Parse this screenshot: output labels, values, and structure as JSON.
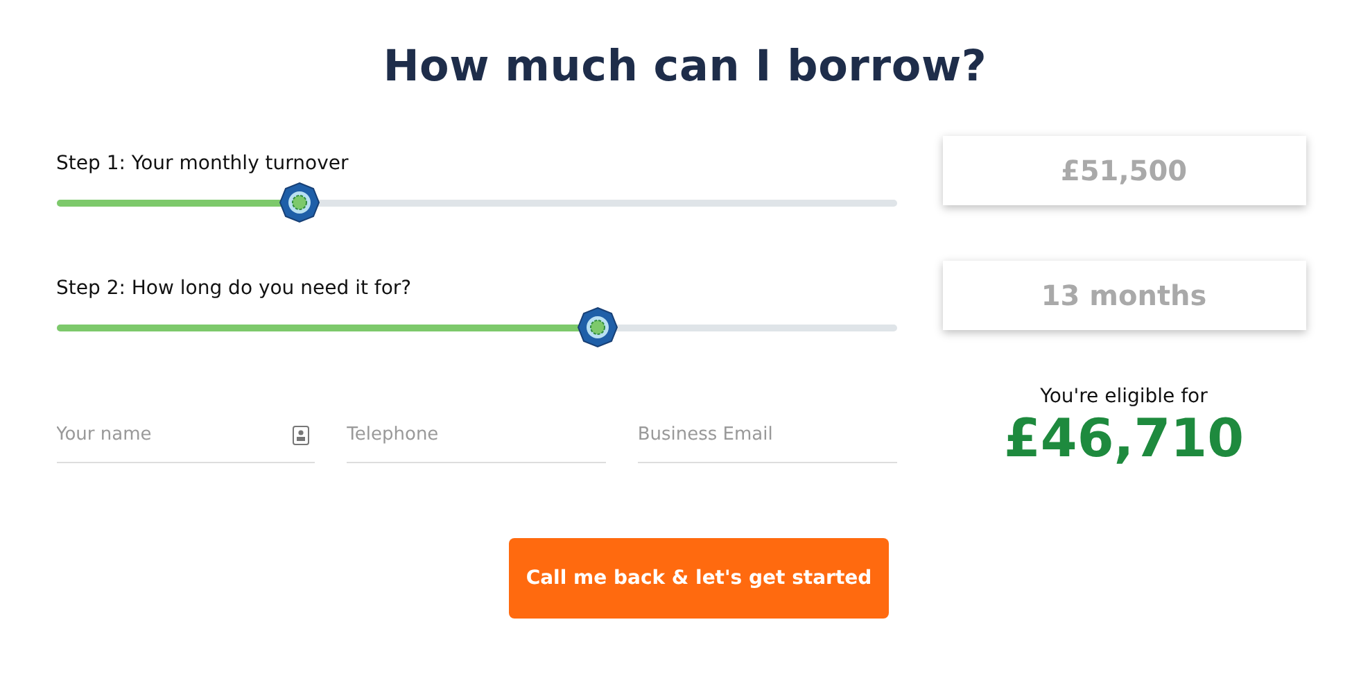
{
  "title": "How much can I borrow?",
  "steps": [
    {
      "label": "Step 1: Your monthly turnover",
      "level": 0.29,
      "reading": "£51,500"
    },
    {
      "label": "Step 2: How long do you need it for?",
      "level": 0.644,
      "reading": "13 months"
    }
  ],
  "fields": [
    {
      "placeholder": "Your name",
      "kind": "contact"
    },
    {
      "placeholder": "Telephone",
      "kind": "plain"
    },
    {
      "placeholder": "Business Email",
      "kind": "plain"
    }
  ],
  "result": {
    "label": "You're eligible for",
    "amount": "£46,710"
  },
  "button": "Call me back & let's get started"
}
